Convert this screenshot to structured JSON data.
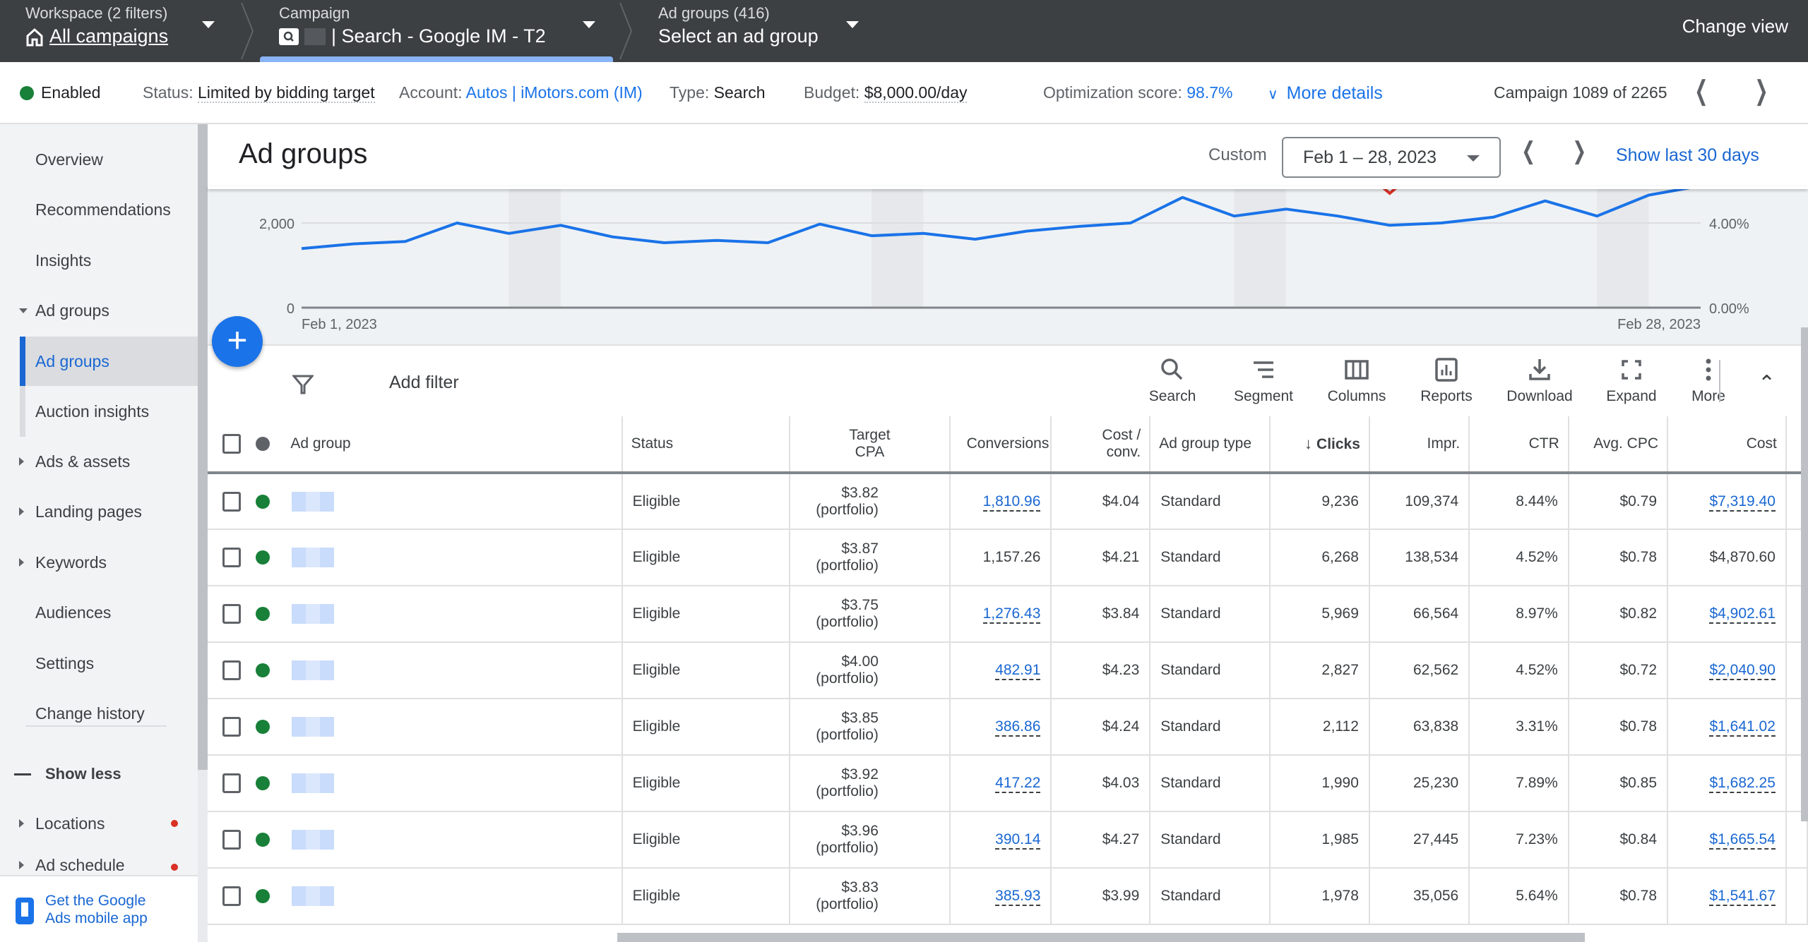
{
  "topbar": {
    "workspace_label": "Workspace (2 filters)",
    "workspace_value": "All campaigns",
    "campaign_label": "Campaign",
    "campaign_value": "| Search - Google IM - T2",
    "adgroups_label": "Ad groups (416)",
    "adgroups_value": "Select an ad group",
    "change_view": "Change view"
  },
  "statusbar": {
    "enabled": "Enabled",
    "status_key": "Status:",
    "status_val": "Limited by bidding target",
    "account_key": "Account:",
    "account_val": "Autos | iMotors.com (IM)",
    "type_key": "Type:",
    "type_val": "Search",
    "budget_key": "Budget:",
    "budget_val": "$8,000.00/day",
    "opt_key": "Optimization score:",
    "opt_val": "98.7%",
    "more_details": "More details",
    "campaign_pos": "Campaign 1089 of 2265"
  },
  "sidebar": {
    "items": [
      {
        "label": "Overview"
      },
      {
        "label": "Recommendations"
      },
      {
        "label": "Insights"
      },
      {
        "label": "Ad groups"
      },
      {
        "label": "Ad groups"
      },
      {
        "label": "Auction insights"
      },
      {
        "label": "Ads & assets"
      },
      {
        "label": "Landing pages"
      },
      {
        "label": "Keywords"
      },
      {
        "label": "Audiences"
      },
      {
        "label": "Settings"
      },
      {
        "label": "Change history"
      },
      {
        "label": "Show less"
      },
      {
        "label": "Locations"
      },
      {
        "label": "Ad schedule"
      }
    ],
    "app_promo": "Get the Google Ads mobile app"
  },
  "header": {
    "title": "Ad groups",
    "date_preset": "Custom",
    "date_range": "Feb 1 – 28, 2023",
    "show_last_30": "Show last 30 days"
  },
  "toolbar": {
    "add_filter": "Add filter",
    "tools": [
      "Search",
      "Segment",
      "Columns",
      "Reports",
      "Download",
      "Expand",
      "More"
    ]
  },
  "chart_data": {
    "type": "line",
    "title": "",
    "x_start_label": "Feb 1, 2023",
    "x_end_label": "Feb 28, 2023",
    "left_axis": {
      "ticks": [
        "0",
        "2,000"
      ],
      "range": [
        0,
        2000
      ]
    },
    "right_axis": {
      "ticks": [
        "0.00%",
        "4.00%"
      ],
      "range": [
        0,
        4
      ]
    },
    "weekend_bands": [
      5,
      6,
      12,
      13,
      19,
      20,
      26,
      27
    ],
    "series": [
      {
        "name": "Clicks",
        "color": "#1a73e8",
        "values": [
          1397,
          1507,
          1562,
          2000,
          1753,
          1945,
          1671,
          1534,
          1589,
          1534,
          1973,
          1699,
          1753,
          1616,
          1808,
          1918,
          2000,
          2603,
          2164,
          2329,
          2164,
          1945,
          2000,
          2137,
          2521,
          2164,
          2658,
          2877
        ]
      }
    ],
    "annotation_marker_day": 22,
    "annotation_color": "#d93025",
    "grid": true
  },
  "table": {
    "headers": [
      "Ad group",
      "Status",
      "Target CPA",
      "Conversions",
      "Cost / conv.",
      "Ad group type",
      "Clicks",
      "Impr.",
      "CTR",
      "Avg. CPC",
      "Cost"
    ],
    "sort_column": "Clicks",
    "rows": [
      {
        "status": "Eligible",
        "tcpa": "$3.82",
        "tcpa_note": "(portfolio)",
        "conv": "1,810.96",
        "conv_link": true,
        "cpc_conv": "$4.04",
        "type": "Standard",
        "clicks": "9,236",
        "impr": "109,374",
        "ctr": "8.44%",
        "avg_cpc": "$0.79",
        "cost": "$7,319.40",
        "cost_link": true
      },
      {
        "status": "Eligible",
        "tcpa": "$3.87",
        "tcpa_note": "(portfolio)",
        "conv": "1,157.26",
        "conv_link": false,
        "cpc_conv": "$4.21",
        "type": "Standard",
        "clicks": "6,268",
        "impr": "138,534",
        "ctr": "4.52%",
        "avg_cpc": "$0.78",
        "cost": "$4,870.60",
        "cost_link": false
      },
      {
        "status": "Eligible",
        "tcpa": "$3.75",
        "tcpa_note": "(portfolio)",
        "conv": "1,276.43",
        "conv_link": true,
        "cpc_conv": "$3.84",
        "type": "Standard",
        "clicks": "5,969",
        "impr": "66,564",
        "ctr": "8.97%",
        "avg_cpc": "$0.82",
        "cost": "$4,902.61",
        "cost_link": true
      },
      {
        "status": "Eligible",
        "tcpa": "$4.00",
        "tcpa_note": "(portfolio)",
        "conv": "482.91",
        "conv_link": true,
        "cpc_conv": "$4.23",
        "type": "Standard",
        "clicks": "2,827",
        "impr": "62,562",
        "ctr": "4.52%",
        "avg_cpc": "$0.72",
        "cost": "$2,040.90",
        "cost_link": true
      },
      {
        "status": "Eligible",
        "tcpa": "$3.85",
        "tcpa_note": "(portfolio)",
        "conv": "386.86",
        "conv_link": true,
        "cpc_conv": "$4.24",
        "type": "Standard",
        "clicks": "2,112",
        "impr": "63,838",
        "ctr": "3.31%",
        "avg_cpc": "$0.78",
        "cost": "$1,641.02",
        "cost_link": true
      },
      {
        "status": "Eligible",
        "tcpa": "$3.92",
        "tcpa_note": "(portfolio)",
        "conv": "417.22",
        "conv_link": true,
        "cpc_conv": "$4.03",
        "type": "Standard",
        "clicks": "1,990",
        "impr": "25,230",
        "ctr": "7.89%",
        "avg_cpc": "$0.85",
        "cost": "$1,682.25",
        "cost_link": true
      },
      {
        "status": "Eligible",
        "tcpa": "$3.96",
        "tcpa_note": "(portfolio)",
        "conv": "390.14",
        "conv_link": true,
        "cpc_conv": "$4.27",
        "type": "Standard",
        "clicks": "1,985",
        "impr": "27,445",
        "ctr": "7.23%",
        "avg_cpc": "$0.84",
        "cost": "$1,665.54",
        "cost_link": true
      },
      {
        "status": "Eligible",
        "tcpa": "$3.83",
        "tcpa_note": "(portfolio)",
        "conv": "385.93",
        "conv_link": true,
        "cpc_conv": "$3.99",
        "type": "Standard",
        "clicks": "1,978",
        "impr": "35,056",
        "ctr": "5.64%",
        "avg_cpc": "$0.78",
        "cost": "$1,541.67",
        "cost_link": true
      }
    ]
  },
  "colors": {
    "accent": "#1a73e8",
    "enabled_green": "#188038",
    "topbar_bg": "#3c4043",
    "alert_red": "#d93025"
  }
}
